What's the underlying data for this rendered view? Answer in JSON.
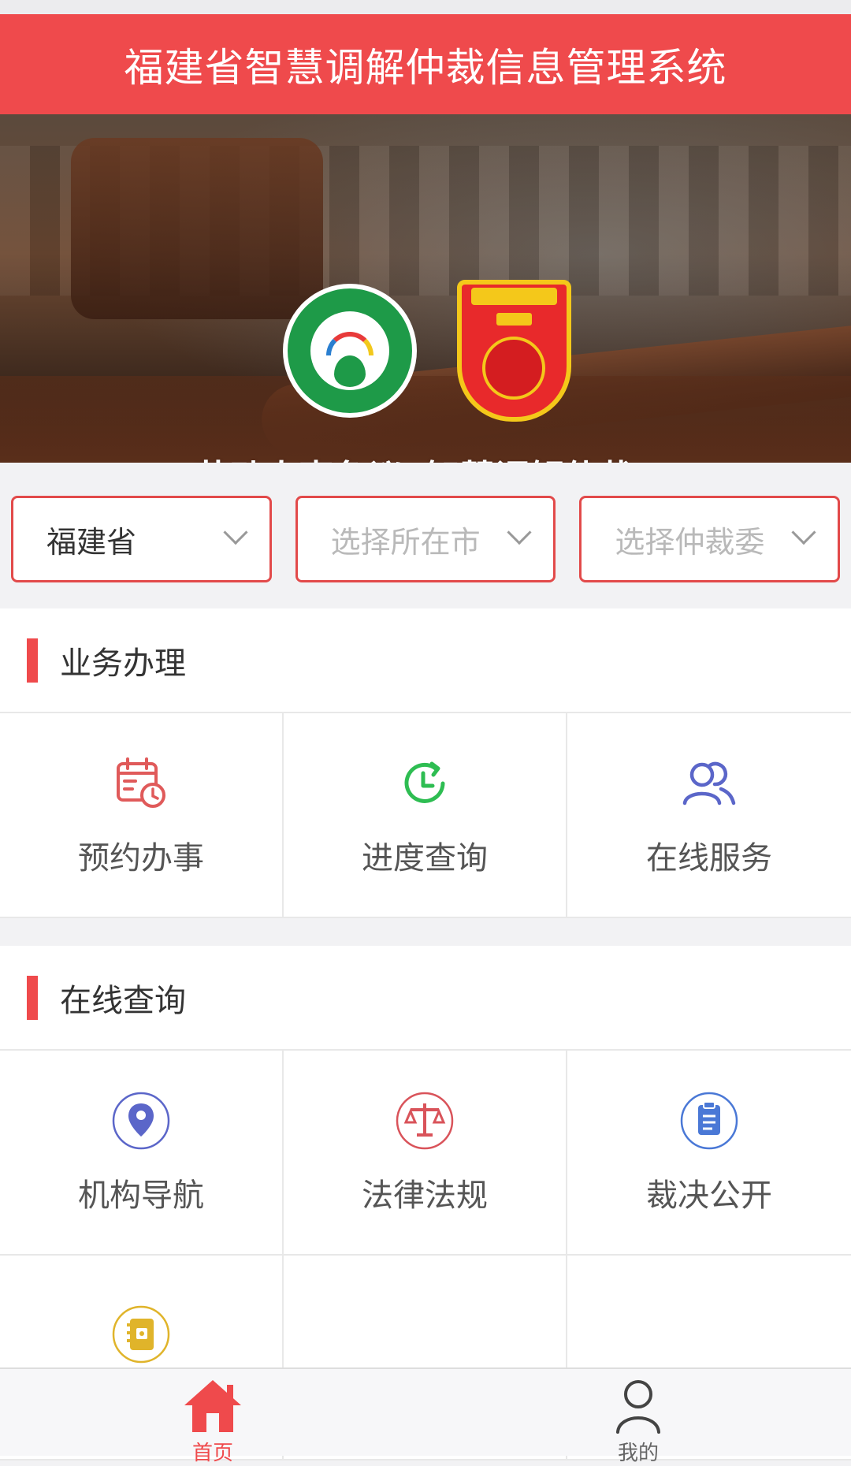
{
  "header": {
    "title": "福建省智慧调解仲裁信息管理系统"
  },
  "banner": {
    "slogan": "劳动人事争议“智慧调解仲裁”"
  },
  "selectors": [
    {
      "value": "福建省",
      "placeholder": false
    },
    {
      "value": "选择所在市",
      "placeholder": true
    },
    {
      "value": "选择仲裁委",
      "placeholder": true
    }
  ],
  "sections": {
    "business": {
      "title": "业务办理",
      "items": [
        {
          "label": "预约办事",
          "icon": "calendar-clock-icon",
          "color": "#e05a5a"
        },
        {
          "label": "进度查询",
          "icon": "clock-refresh-icon",
          "color": "#2ebd52"
        },
        {
          "label": "在线服务",
          "icon": "users-icon",
          "color": "#5b66c9"
        }
      ]
    },
    "query": {
      "title": "在线查询",
      "items": [
        {
          "label": "机构导航",
          "icon": "location-pin-icon",
          "color": "#5b66c9"
        },
        {
          "label": "法律法规",
          "icon": "scales-icon",
          "color": "#d9535a"
        },
        {
          "label": "裁决公开",
          "icon": "clipboard-icon",
          "color": "#4a78d6"
        },
        {
          "label": "",
          "icon": "notebook-icon",
          "color": "#e0b42a"
        }
      ]
    }
  },
  "tabbar": {
    "home": {
      "label": "首页",
      "icon": "home-icon",
      "color": "#ef4a4c"
    },
    "mine": {
      "label": "我的",
      "icon": "user-icon"
    }
  }
}
